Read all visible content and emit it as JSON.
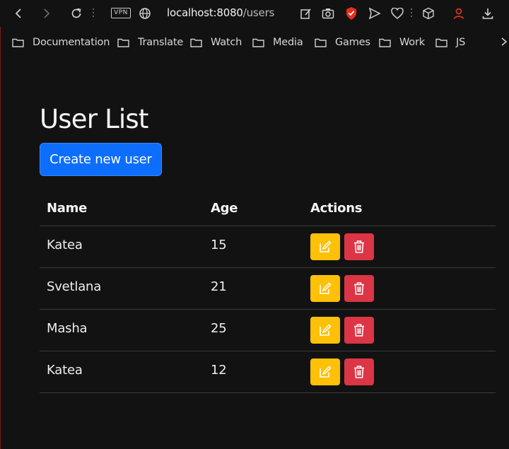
{
  "browser": {
    "vpn_label": "VPN",
    "url_host": "localhost:8080",
    "url_path": "/users",
    "accent_shield": "#e52e20",
    "accent_profile": "#e0321f"
  },
  "bookmarks": [
    {
      "label": "Documentation"
    },
    {
      "label": "Translate"
    },
    {
      "label": "Watch"
    },
    {
      "label": "Media"
    },
    {
      "label": "Games"
    },
    {
      "label": "Work"
    },
    {
      "label": "JS"
    }
  ],
  "page": {
    "title": "User List",
    "create_button": "Create new user",
    "accent": "#0d6efd"
  },
  "table": {
    "headers": [
      "Name",
      "Age",
      "Actions"
    ],
    "rows": [
      {
        "name": "Katea",
        "age": "15"
      },
      {
        "name": "Svetlana",
        "age": "21"
      },
      {
        "name": "Masha",
        "age": "25"
      },
      {
        "name": "Katea",
        "age": "12"
      }
    ],
    "edit_color": "#ffc107",
    "delete_color": "#dc3545"
  }
}
